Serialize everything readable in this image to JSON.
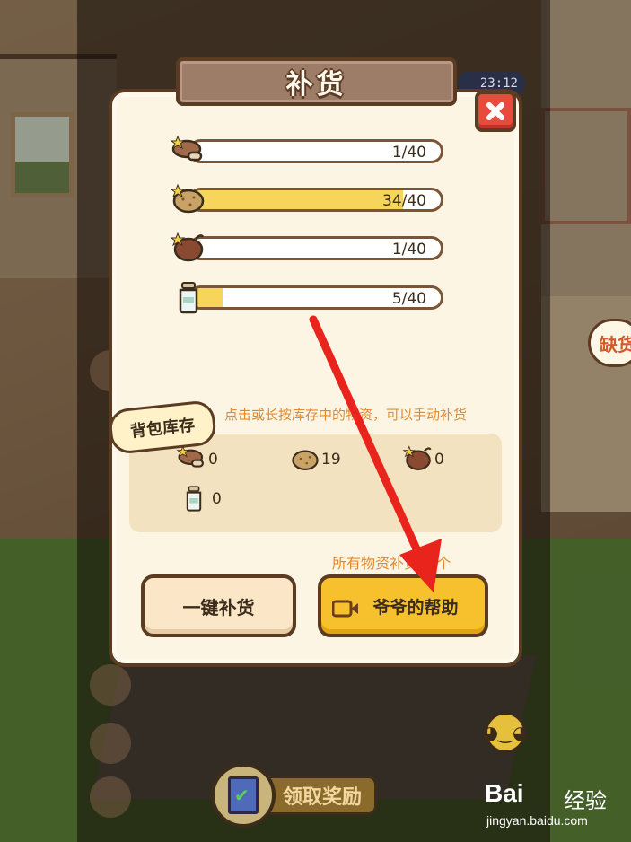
{
  "dialog": {
    "title": "补货",
    "close_icon": "close-icon"
  },
  "status": {
    "time": "23:12"
  },
  "restock_items": [
    {
      "icon": "mushroom-icon",
      "progress": "1/40",
      "fill": 0.025
    },
    {
      "icon": "potato-icon",
      "progress": "34/40",
      "fill": 0.85
    },
    {
      "icon": "sweet-potato-icon",
      "progress": "1/40",
      "fill": 0.025
    },
    {
      "icon": "milk-bottle-icon",
      "progress": "5/40",
      "fill": 0.125
    }
  ],
  "inventory": {
    "tag": "背包库存",
    "hint": "点击或长按库存中的物资，可以手动补货",
    "items": [
      {
        "icon": "mushroom-icon",
        "count": "0"
      },
      {
        "icon": "potato-icon",
        "count": "19"
      },
      {
        "icon": "sweet-potato-icon",
        "count": "0"
      },
      {
        "icon": "milk-bottle-icon",
        "count": "0"
      }
    ]
  },
  "buttons": {
    "total_hint": "所有物资补货10个",
    "one_click_restock": "一键补货",
    "grandpa_help": "爷爷的帮助"
  },
  "background": {
    "claim_reward": "领取奖励",
    "shortage": "缺货"
  },
  "watermark": {
    "logo": "Bai",
    "brand": "经验",
    "url": "jingyan.baidu.com"
  },
  "colors": {
    "accent": "#f7c12e",
    "close": "#e64b3c",
    "arrow": "#e8241c"
  }
}
